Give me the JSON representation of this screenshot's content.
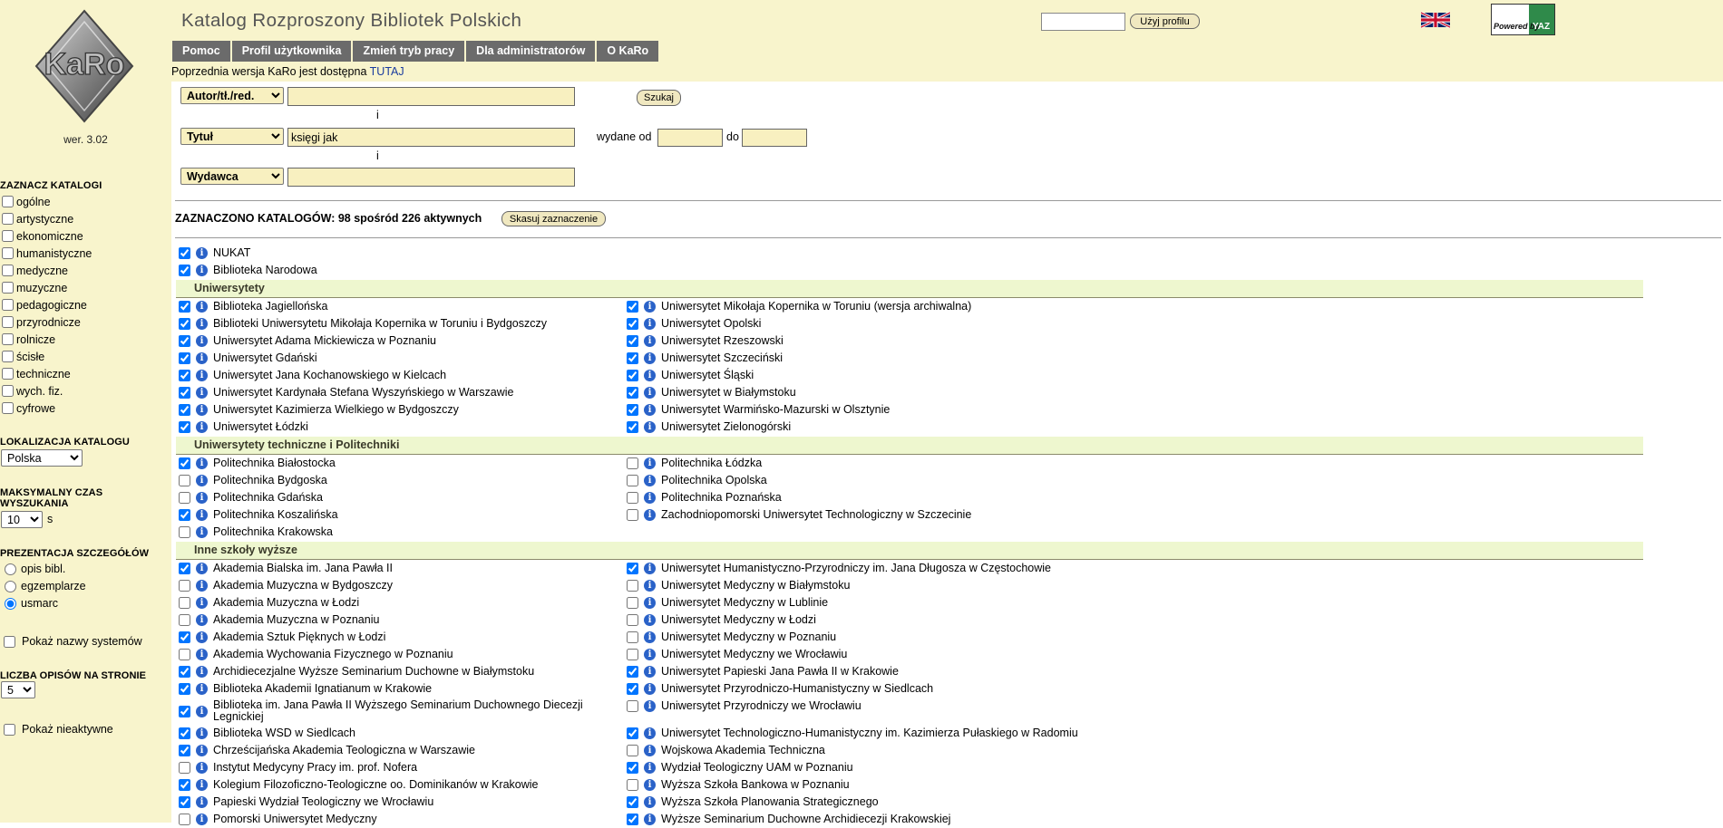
{
  "sidebar": {
    "version": "wer. 3.02",
    "catalog_heading": "ZAZNACZ KATALOGI",
    "categories": [
      {
        "label": "ogólne",
        "checked": false
      },
      {
        "label": "artystyczne",
        "checked": false
      },
      {
        "label": "ekonomiczne",
        "checked": false
      },
      {
        "label": "humanistyczne",
        "checked": false
      },
      {
        "label": "medyczne",
        "checked": false
      },
      {
        "label": "muzyczne",
        "checked": false
      },
      {
        "label": "pedagogiczne",
        "checked": false
      },
      {
        "label": "przyrodnicze",
        "checked": false
      },
      {
        "label": "rolnicze",
        "checked": false
      },
      {
        "label": "ścisłe",
        "checked": false
      },
      {
        "label": "techniczne",
        "checked": false
      },
      {
        "label": "wych. fiz.",
        "checked": false
      },
      {
        "label": "cyfrowe",
        "checked": false
      }
    ],
    "location_heading": "LOKALIZACJA KATALOGU",
    "location_value": "Polska",
    "max_time_heading_1": "MAKSYMALNY CZAS",
    "max_time_heading_2": "WYSZUKANIA",
    "max_time_value": "10",
    "max_time_unit": "s",
    "details_heading": "PREZENTACJA SZCZEGÓŁÓW",
    "details_options": [
      {
        "label": "opis bibl.",
        "checked": false
      },
      {
        "label": "egzemplarze",
        "checked": false
      },
      {
        "label": "usmarc",
        "checked": true
      }
    ],
    "show_system_names": "Pokaż nazwy systemów",
    "per_page_heading": "LICZBA OPISÓW NA STRONIE",
    "per_page_value": "5",
    "show_inactive": "Pokaż nieaktywne"
  },
  "header": {
    "title": "Katalog Rozproszony Bibliotek Polskich",
    "nav": [
      "Pomoc",
      "Profil użytkownika",
      "Zmień tryb pracy",
      "Dla administratorów",
      "O KaRo"
    ],
    "notice_text": "Poprzednia wersja KaRo jest dostępna ",
    "notice_link": "TUTAJ",
    "profile_button": "Użyj profilu",
    "powered_by": "Powered by",
    "yaz": "YAZ"
  },
  "search": {
    "field1_label": "Autor/tł./red.",
    "field1_value": "",
    "and1": "i",
    "field2_label": "Tytuł",
    "field2_value": "księgi jak",
    "and2": "i",
    "field3_label": "Wydawca",
    "field3_value": "",
    "search_button": "Szukaj",
    "year_label": "wydane od",
    "year_to_label": "do"
  },
  "catalogs": {
    "summary_prefix": "ZAZNACZONO KATALOGÓW: ",
    "summary_count": "98 spośród 226 aktywnych",
    "clear_button": "Skasuj zaznaczenie",
    "top": [
      {
        "name": "NUKAT",
        "checked": true
      },
      {
        "name": "Biblioteka Narodowa",
        "checked": true
      }
    ],
    "sections": [
      {
        "title": "Uniwersytety",
        "left": [
          {
            "name": "Biblioteka Jagiellońska",
            "checked": true
          },
          {
            "name": "Biblioteki Uniwersytetu Mikołaja Kopernika w Toruniu i Bydgoszczy",
            "checked": true
          },
          {
            "name": "Uniwersytet Adama Mickiewicza w Poznaniu",
            "checked": true
          },
          {
            "name": "Uniwersytet Gdański",
            "checked": true
          },
          {
            "name": "Uniwersytet Jana Kochanowskiego w Kielcach",
            "checked": true
          },
          {
            "name": "Uniwersytet Kardynała Stefana Wyszyńskiego w Warszawie",
            "checked": true
          },
          {
            "name": "Uniwersytet Kazimierza Wielkiego w Bydgoszczy",
            "checked": true
          },
          {
            "name": "Uniwersytet Łódzki",
            "checked": true
          }
        ],
        "right": [
          {
            "name": "Uniwersytet Mikołaja Kopernika w Toruniu (wersja archiwalna)",
            "checked": true
          },
          {
            "name": "Uniwersytet Opolski",
            "checked": true
          },
          {
            "name": "Uniwersytet Rzeszowski",
            "checked": true
          },
          {
            "name": "Uniwersytet Szczeciński",
            "checked": true
          },
          {
            "name": "Uniwersytet Śląski",
            "checked": true
          },
          {
            "name": "Uniwersytet w Białymstoku",
            "checked": true
          },
          {
            "name": "Uniwersytet Warmińsko-Mazurski w Olsztynie",
            "checked": true
          },
          {
            "name": "Uniwersytet Zielonogórski",
            "checked": true
          }
        ]
      },
      {
        "title": "Uniwersytety techniczne i Politechniki",
        "left": [
          {
            "name": "Politechnika Białostocka",
            "checked": true
          },
          {
            "name": "Politechnika Bydgoska",
            "checked": false
          },
          {
            "name": "Politechnika Gdańska",
            "checked": false
          },
          {
            "name": "Politechnika Koszalińska",
            "checked": true
          },
          {
            "name": "Politechnika Krakowska",
            "checked": false
          }
        ],
        "right": [
          {
            "name": "Politechnika Łódzka",
            "checked": false
          },
          {
            "name": "Politechnika Opolska",
            "checked": false
          },
          {
            "name": "Politechnika Poznańska",
            "checked": false
          },
          {
            "name": "Zachodniopomorski Uniwersytet Technologiczny w Szczecinie",
            "checked": false
          }
        ]
      },
      {
        "title": "Inne szkoły wyższe",
        "left": [
          {
            "name": "Akademia Bialska im. Jana Pawła II",
            "checked": true
          },
          {
            "name": "Akademia Muzyczna w Bydgoszczy",
            "checked": false
          },
          {
            "name": "Akademia Muzyczna w Łodzi",
            "checked": false
          },
          {
            "name": "Akademia Muzyczna w Poznaniu",
            "checked": false
          },
          {
            "name": "Akademia Sztuk Pięknych w Łodzi",
            "checked": true
          },
          {
            "name": "Akademia Wychowania Fizycznego w Poznaniu",
            "checked": false
          },
          {
            "name": "Archidiecezjalne Wyższe Seminarium Duchowne w Białymstoku",
            "checked": true
          },
          {
            "name": "Biblioteka Akademii Ignatianum w Krakowie",
            "checked": true
          },
          {
            "name": "Biblioteka im. Jana Pawła II Wyższego Seminarium Duchownego Diecezji Legnickiej",
            "checked": true
          },
          {
            "name": "Biblioteka WSD w Siedlcach",
            "checked": true
          },
          {
            "name": "Chrześcijańska Akademia Teologiczna w Warszawie",
            "checked": true
          },
          {
            "name": "Instytut Medycyny Pracy im. prof. Nofera",
            "checked": false
          },
          {
            "name": "Kolegium Filozoficzno-Teologiczne oo. Dominikanów w Krakowie",
            "checked": true
          },
          {
            "name": "Papieski Wydział Teologiczny we Wrocławiu",
            "checked": true
          },
          {
            "name": "Pomorski Uniwersytet Medyczny",
            "checked": false
          }
        ],
        "right": [
          {
            "name": "Uniwersytet Humanistyczno-Przyrodniczy im. Jana Długosza w Częstochowie",
            "checked": true
          },
          {
            "name": "Uniwersytet Medyczny w Białymstoku",
            "checked": false
          },
          {
            "name": "Uniwersytet Medyczny w Lublinie",
            "checked": false
          },
          {
            "name": "Uniwersytet Medyczny w Łodzi",
            "checked": false
          },
          {
            "name": "Uniwersytet Medyczny w Poznaniu",
            "checked": false
          },
          {
            "name": "Uniwersytet Medyczny we Wrocławiu",
            "checked": false
          },
          {
            "name": "Uniwersytet Papieski Jana Pawła II w Krakowie",
            "checked": true
          },
          {
            "name": "Uniwersytet Przyrodniczo-Humanistyczny w Siedlcach",
            "checked": true
          },
          {
            "name": "Uniwersytet Przyrodniczy we Wrocławiu",
            "checked": false
          },
          {
            "name": "Uniwersytet Technologiczno-Humanistyczny im. Kazimierza Pułaskiego w Radomiu",
            "checked": true
          },
          {
            "name": "Wojskowa Akademia Techniczna",
            "checked": false
          },
          {
            "name": "Wydział Teologiczny UAM w Poznaniu",
            "checked": true
          },
          {
            "name": "Wyższa Szkoła Bankowa w Poznaniu",
            "checked": false
          },
          {
            "name": "Wyższa Szkoła Planowania Strategicznego",
            "checked": true
          },
          {
            "name": "Wyższe Seminarium Duchowne Archidiecezji Krakowskiej",
            "checked": true
          }
        ]
      }
    ]
  }
}
